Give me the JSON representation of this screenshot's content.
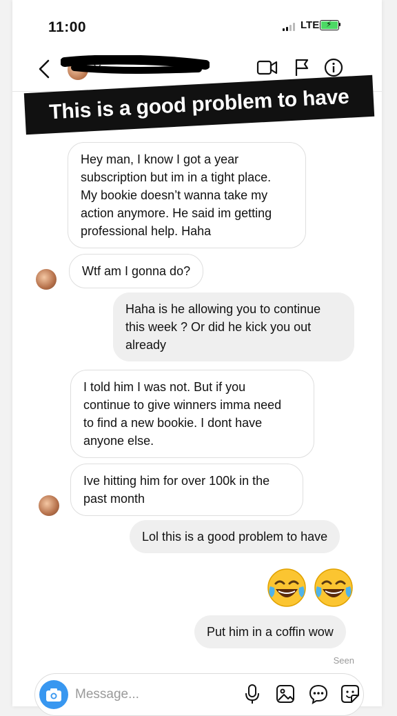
{
  "status_bar": {
    "time": "11:00",
    "network": "LTE"
  },
  "header": {
    "contact_name": "Yu..."
  },
  "banner": {
    "text": "This is a good problem to have"
  },
  "messages": [
    {
      "side": "received",
      "text": "Hey man, I know I got a year\nsubscription but im in a tight place.\nMy bookie doesn’t wanna take my\naction anymore. He said im getting\nprofessional help. Haha"
    },
    {
      "side": "received",
      "text": "Wtf am I gonna do?"
    },
    {
      "side": "sent",
      "text": "Haha is he allowing you to continue\nthis week ? Or did he kick you out\nalready"
    },
    {
      "side": "received",
      "text": "I told him I was not. But if you\ncontinue to give winners imma need\nto find a new bookie. I dont have\nanyone else."
    },
    {
      "side": "received",
      "text": "Ive hitting him for over 100k in the\npast month"
    },
    {
      "side": "sent",
      "text": "Lol this is a good problem to have"
    },
    {
      "side": "sent",
      "emoji": "😂😂"
    },
    {
      "side": "sent",
      "text": "Put him in a coffin wow"
    }
  ],
  "seen_label": "Seen",
  "composer": {
    "placeholder": "Message..."
  },
  "colors": {
    "accent": "#3897f0",
    "sent_bubble": "#efefef",
    "banner_bg": "#111111"
  },
  "icons": [
    "back-icon",
    "video-call-icon",
    "flag-icon",
    "info-icon",
    "camera-icon",
    "microphone-icon",
    "gallery-icon",
    "more-icon",
    "sticker-icon",
    "face-with-tears-of-joy-icon"
  ]
}
